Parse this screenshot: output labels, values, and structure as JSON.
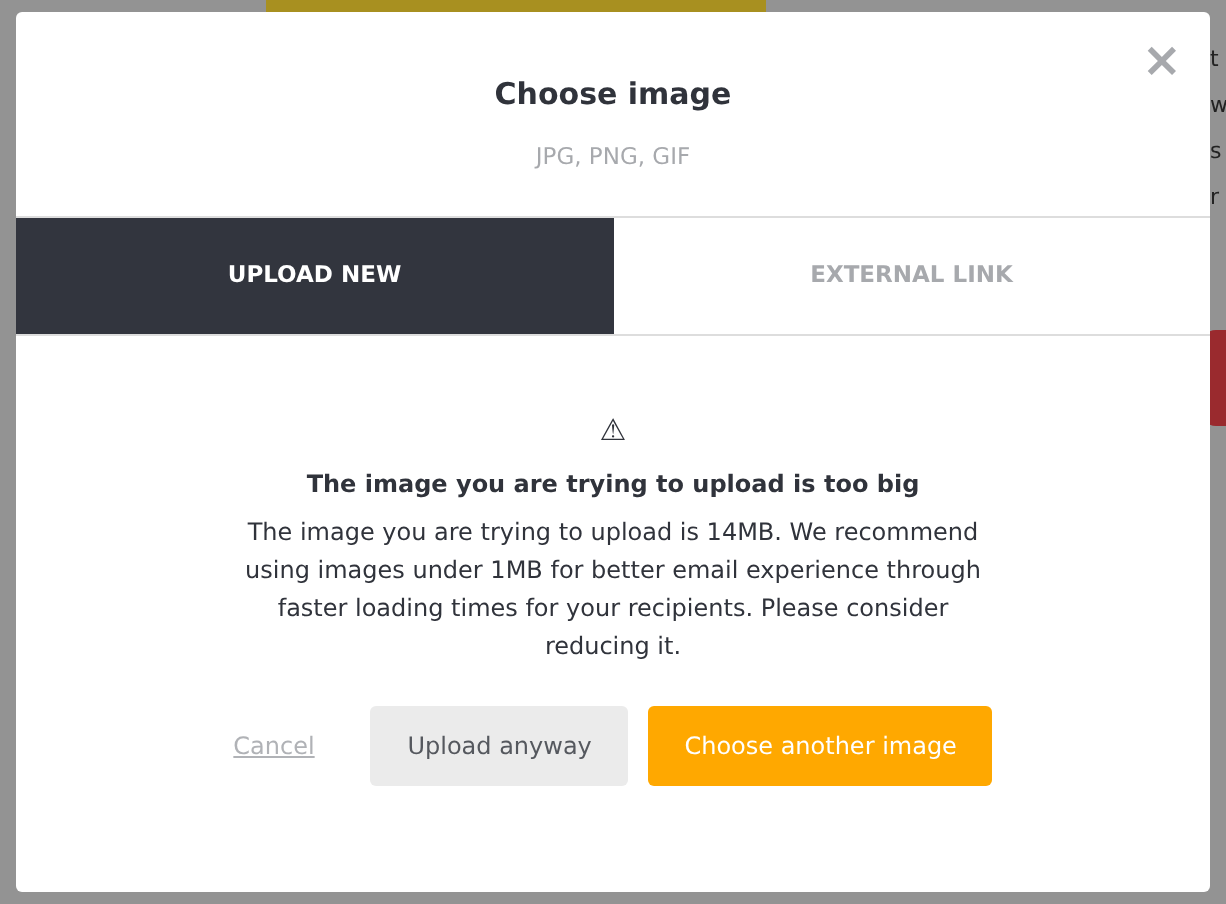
{
  "background": {
    "text_fragments": [
      "t",
      "w",
      "s",
      "r"
    ]
  },
  "dialog": {
    "title": "Choose image",
    "subtitle": "JPG, PNG, GIF",
    "close": "×"
  },
  "tabs": [
    {
      "label": "UPLOAD NEW",
      "selected": true
    },
    {
      "label": "EXTERNAL LINK",
      "selected": false
    }
  ],
  "warning": {
    "icon": "⚠",
    "heading": "The image you are trying to upload is too big",
    "message": "The image you are trying to upload is 14MB. We recommend using images under 1MB for better email experience through faster loading times for your recipients. Please consider reducing it."
  },
  "actions": [
    {
      "kind": "link",
      "label": "Cancel"
    },
    {
      "kind": "secondary",
      "label": "Upload anyway"
    },
    {
      "kind": "primary",
      "label": "Choose another image"
    }
  ]
}
